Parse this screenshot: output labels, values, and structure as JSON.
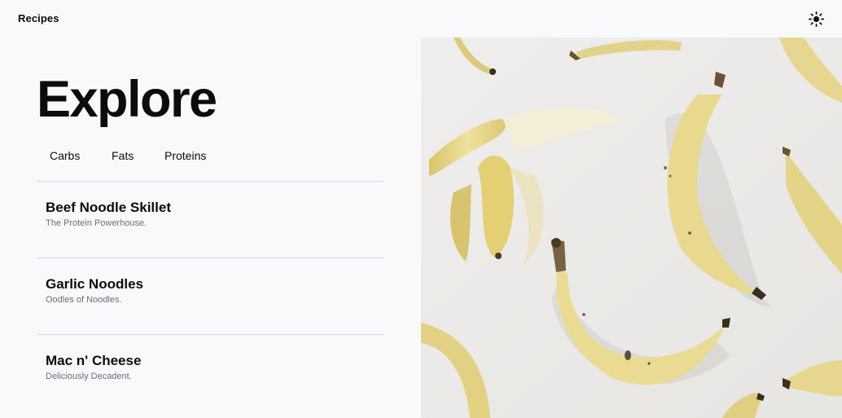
{
  "header": {
    "brand": "Recipes",
    "theme_icon": "sun-icon"
  },
  "main": {
    "title": "Explore",
    "tabs": [
      {
        "label": "Carbs"
      },
      {
        "label": "Fats"
      },
      {
        "label": "Proteins"
      }
    ],
    "recipes": [
      {
        "name": "Beef Noodle Skillet",
        "description": "The Protein Powerhouse."
      },
      {
        "name": "Garlic Noodles",
        "description": "Oodles of Noodles."
      },
      {
        "name": "Mac n' Cheese",
        "description": "Deliciously Decadent."
      }
    ]
  },
  "hero": {
    "image_subject": "bananas-photo"
  },
  "colors": {
    "background": "#f8f9fb",
    "divider": "#d7d9dd",
    "banana": "#e8d98f",
    "photo_background": "#ecebe8"
  }
}
